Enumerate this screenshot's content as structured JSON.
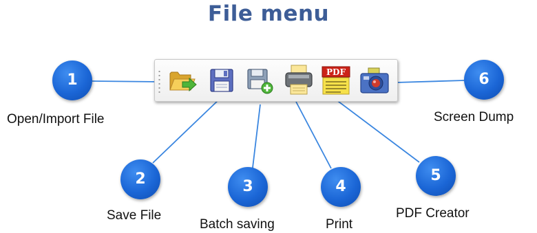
{
  "title": "File menu",
  "colors": {
    "title": "#3d5d97",
    "badge": "#1b66d6",
    "connector": "#3a86e0"
  },
  "toolbar": {
    "buttons": [
      {
        "id": "open",
        "icon": "open-folder-icon"
      },
      {
        "id": "save",
        "icon": "floppy-disk-icon"
      },
      {
        "id": "batch",
        "icon": "batch-save-icon"
      },
      {
        "id": "print",
        "icon": "printer-icon"
      },
      {
        "id": "pdf",
        "icon": "pdf-icon",
        "text": "PDF"
      },
      {
        "id": "screen",
        "icon": "camera-icon"
      }
    ]
  },
  "callouts": [
    {
      "number": "1",
      "label": "Open/Import File"
    },
    {
      "number": "2",
      "label": "Save File"
    },
    {
      "number": "3",
      "label": "Batch saving"
    },
    {
      "number": "4",
      "label": "Print"
    },
    {
      "number": "5",
      "label": "PDF Creator"
    },
    {
      "number": "6",
      "label": "Screen Dump"
    }
  ]
}
